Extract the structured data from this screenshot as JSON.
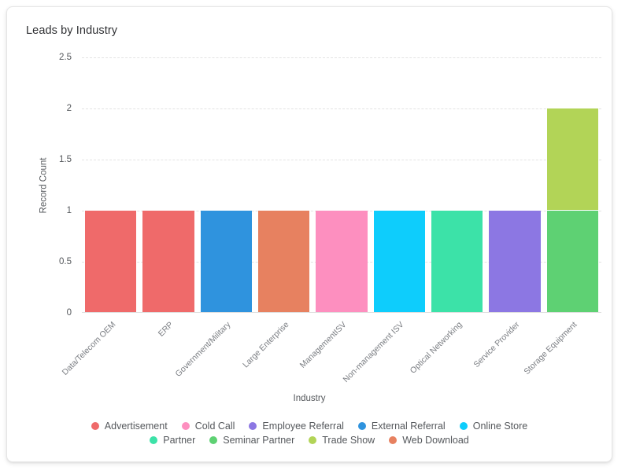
{
  "card": {
    "title": "Leads by Industry"
  },
  "chart_data": {
    "type": "bar",
    "stacked": true,
    "title": "Leads by Industry",
    "xlabel": "Industry",
    "ylabel": "Record Count",
    "ylim": [
      0,
      2.5
    ],
    "yticks": [
      "0",
      "0.5",
      "1",
      "1.5",
      "2",
      "2.5"
    ],
    "ytick_values": [
      0,
      0.5,
      1,
      1.5,
      2,
      2.5
    ],
    "grid": true,
    "legend_position": "bottom",
    "categories": [
      "Data/Telecom OEM",
      "ERP",
      "Government/Military",
      "Large Enterprise",
      "ManagementISV",
      "Non-management ISV",
      "Optical Networking",
      "Service Provider",
      "Storage Equipment"
    ],
    "series": [
      {
        "name": "Advertisement",
        "color": "#ef6a6a",
        "values": [
          1,
          1,
          0,
          0,
          0,
          0,
          0,
          0,
          0
        ]
      },
      {
        "name": "Cold Call",
        "color": "#fd8fbf",
        "values": [
          0,
          0,
          0,
          0,
          1,
          0,
          0,
          0,
          0
        ]
      },
      {
        "name": "Employee Referral",
        "color": "#8c77e3",
        "values": [
          0,
          0,
          0,
          0,
          0,
          0,
          0,
          1,
          0
        ]
      },
      {
        "name": "External Referral",
        "color": "#2f93de",
        "values": [
          0,
          0,
          1,
          0,
          0,
          0,
          0,
          0,
          0
        ]
      },
      {
        "name": "Online Store",
        "color": "#0ecdfc",
        "values": [
          0,
          0,
          0,
          0,
          0,
          1,
          0,
          0,
          0
        ]
      },
      {
        "name": "Partner",
        "color": "#3ce2a8",
        "values": [
          0,
          0,
          0,
          0,
          0,
          0,
          1,
          0,
          0
        ]
      },
      {
        "name": "Seminar Partner",
        "color": "#5ed173",
        "values": [
          0,
          0,
          0,
          0,
          0,
          0,
          0,
          0,
          1
        ]
      },
      {
        "name": "Trade Show",
        "color": "#b2d457",
        "values": [
          0,
          0,
          0,
          0,
          0,
          0,
          0,
          0,
          1
        ]
      },
      {
        "name": "Web Download",
        "color": "#e78160",
        "values": [
          0,
          0,
          0,
          1,
          0,
          0,
          0,
          0,
          0
        ]
      }
    ],
    "bar_totals": [
      1,
      1,
      1,
      1,
      1,
      1,
      1,
      1,
      2
    ]
  },
  "legend": {
    "items": [
      {
        "label": "Advertisement",
        "color": "#ef6a6a"
      },
      {
        "label": "Cold Call",
        "color": "#fd8fbf"
      },
      {
        "label": "Employee Referral",
        "color": "#8c77e3"
      },
      {
        "label": "External Referral",
        "color": "#2f93de"
      },
      {
        "label": "Online Store",
        "color": "#0ecdfc"
      },
      {
        "label": "Partner",
        "color": "#3ce2a8"
      },
      {
        "label": "Seminar Partner",
        "color": "#5ed173"
      },
      {
        "label": "Trade Show",
        "color": "#b2d457"
      },
      {
        "label": "Web Download",
        "color": "#e78160"
      }
    ]
  }
}
